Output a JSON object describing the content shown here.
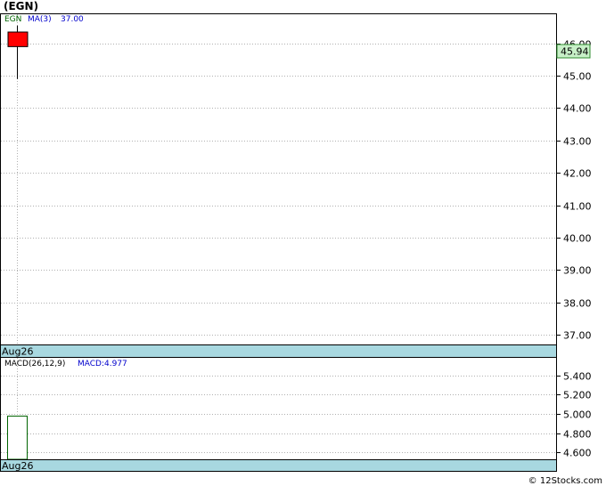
{
  "header": {
    "title": "(EGN)"
  },
  "footer": {
    "credit": "© 12Stocks.com"
  },
  "colors": {
    "ticker": "#006400",
    "ma": "#0000cc",
    "macd": "#0000cc",
    "candle_down": "#ff0000",
    "date_band": "#a8d8e0",
    "price_tag": "#c8f0c8",
    "grid": "#b0b0b0"
  },
  "chart_data": [
    {
      "type": "candlestick",
      "legend": {
        "ticker": "EGN",
        "ma_label": "MA(3)",
        "ma_value": "37.00"
      },
      "ylim": [
        36.7,
        46.9
      ],
      "yticks": [
        "46.00",
        "45.00",
        "44.00",
        "43.00",
        "42.00",
        "41.00",
        "40.00",
        "39.00",
        "38.00",
        "37.00"
      ],
      "x_label": "Aug26",
      "last_price": "45.94",
      "candles": [
        {
          "date": "Aug26",
          "open": 46.35,
          "close": 45.9,
          "high": 46.55,
          "low": 44.9
        }
      ]
    },
    {
      "type": "bar",
      "legend": {
        "label": "MACD(26,12,9)",
        "value_label": "MACD:4.977"
      },
      "ylim": [
        4.53,
        5.58
      ],
      "yticks": [
        "5.400",
        "5.200",
        "5.000",
        "4.800",
        "4.600"
      ],
      "x_label": "Aug26",
      "values": [
        4.977
      ]
    }
  ]
}
